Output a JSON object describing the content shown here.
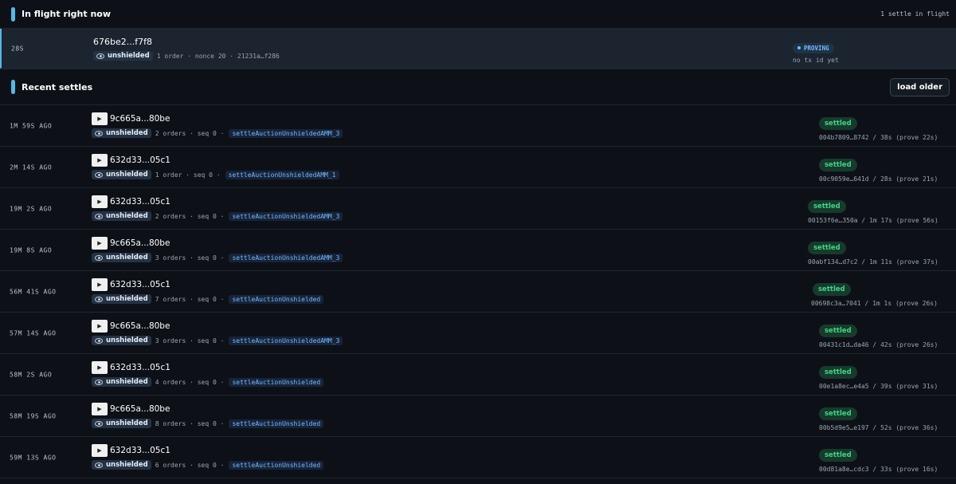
{
  "inflight": {
    "title": "In flight right now",
    "count_label": "1 settle in flight",
    "item": {
      "age": "28S",
      "hash": "676be2...f7f8",
      "badge": "unshielded",
      "meta": "1 order · nonce 20 · 21231a…f286",
      "status": "PROVING",
      "tx": "no tx id yet"
    }
  },
  "recent": {
    "title": "Recent settles",
    "load_label": "load older",
    "play_glyph": "▶",
    "rows": [
      {
        "age": "1M 59S AGO",
        "hash": "9c665a...80be",
        "badge": "unshielded",
        "orders": "2 orders · seq 0 ·",
        "fn": "settleAuctionUnshieldedAMM_3",
        "status": "settled",
        "tx": "004b7809…8742 / 38s (prove 22s)"
      },
      {
        "age": "2M 14S AGO",
        "hash": "632d33...05c1",
        "badge": "unshielded",
        "orders": "1 order · seq 0 ·",
        "fn": "settleAuctionUnshieldedAMM_1",
        "status": "settled",
        "tx": "00c9059e…641d / 28s (prove 21s)"
      },
      {
        "age": "19M 2S AGO",
        "hash": "632d33...05c1",
        "badge": "unshielded",
        "orders": "2 orders · seq 0 ·",
        "fn": "settleAuctionUnshieldedAMM_3",
        "status": "settled",
        "tx": "00153f6e…350a / 1m 17s (prove 56s)"
      },
      {
        "age": "19M 8S AGO",
        "hash": "9c665a...80be",
        "badge": "unshielded",
        "orders": "3 orders · seq 0 ·",
        "fn": "settleAuctionUnshieldedAMM_3",
        "status": "settled",
        "tx": "00abf134…d7c2 / 1m 11s (prove 37s)"
      },
      {
        "age": "56M 41S AGO",
        "hash": "632d33...05c1",
        "badge": "unshielded",
        "orders": "7 orders · seq 0 ·",
        "fn": "settleAuctionUnshielded",
        "status": "settled",
        "tx": "00698c3a…7041 / 1m 1s (prove 26s)"
      },
      {
        "age": "57M 14S AGO",
        "hash": "9c665a...80be",
        "badge": "unshielded",
        "orders": "3 orders · seq 0 ·",
        "fn": "settleAuctionUnshieldedAMM_3",
        "status": "settled",
        "tx": "00431c1d…da46 / 42s (prove 26s)"
      },
      {
        "age": "58M 2S AGO",
        "hash": "632d33...05c1",
        "badge": "unshielded",
        "orders": "4 orders · seq 0 ·",
        "fn": "settleAuctionUnshielded",
        "status": "settled",
        "tx": "00e1a8ec…e4a5 / 39s (prove 31s)"
      },
      {
        "age": "58M 19S AGO",
        "hash": "9c665a...80be",
        "badge": "unshielded",
        "orders": "8 orders · seq 0 ·",
        "fn": "settleAuctionUnshielded",
        "status": "settled",
        "tx": "00b5d9e5…e197 / 52s (prove 36s)"
      },
      {
        "age": "59M 13S AGO",
        "hash": "632d33...05c1",
        "badge": "unshielded",
        "orders": "6 orders · seq 0 ·",
        "fn": "settleAuctionUnshielded",
        "status": "settled",
        "tx": "00d81a8e…cdc3 / 33s (prove 16s)"
      }
    ]
  }
}
